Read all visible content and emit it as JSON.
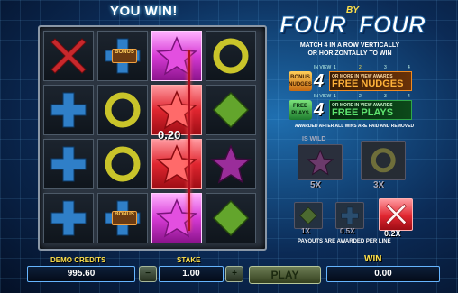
{
  "header": {
    "you_win": "YOU WIN!"
  },
  "logo": {
    "word1": "FOUR",
    "word2": "BY",
    "word3": "FOUR"
  },
  "rules": {
    "line1": "MATCH 4 IN A ROW VERTICALLY",
    "line2": "OR HORIZONTALLY TO WIN",
    "note": "AWARDED AFTER ALL WINS ARE PAID AND REMOVED"
  },
  "nudges_row": {
    "badge_line1": "BONUS",
    "badge_line2": "NUDGES",
    "number": "4",
    "small_text": "OR MORE IN VIEW AWARDS",
    "big_text": "FREE NUDGES",
    "in_view_label": "IN VIEW",
    "in_view_numbers": [
      "1",
      "2",
      "3",
      "4"
    ]
  },
  "freeplays_row": {
    "badge_line1": "FREE",
    "badge_line2": "PLAYS",
    "number": "4",
    "small_text": "OR MORE IN VIEW AWARDS",
    "big_text": "FREE PLAYS",
    "in_view_label": "IN VIEW",
    "in_view_numbers": [
      "1",
      "2",
      "3",
      "4"
    ]
  },
  "grid": {
    "win_amount": "0.20",
    "bonus_tag": "BONUS",
    "cells": [
      [
        "x-red",
        "plus-blue-bonus",
        "star-pink",
        "ring-yellow"
      ],
      [
        "plus-blue",
        "ring-yellow",
        "star-red",
        "diamond-green"
      ],
      [
        "plus-blue",
        "ring-yellow",
        "star-red",
        "star-purple"
      ],
      [
        "plus-blue",
        "plus-blue-bonus",
        "star-pink",
        "diamond-green"
      ]
    ]
  },
  "paytable": {
    "is_wild": "IS WILD",
    "star_mult": "5X",
    "ring_mult": "3X",
    "diamond_mult": "1X",
    "plus_mult": "0.5X",
    "x_mult": "0.2X",
    "payouts_note": "PAYOUTS ARE AWARDED PER LINE"
  },
  "bottom": {
    "credits_label": "DEMO CREDITS",
    "credits_value": "995.60",
    "stake_label": "STAKE",
    "stake_value": "1.00",
    "minus": "−",
    "plus": "+",
    "play": "PLAY",
    "win_label": "WIN",
    "win_value": "0.00"
  },
  "colors": {
    "accent": "#ffe14a",
    "win_red": "#e02630",
    "win_pink": "#d63bd5",
    "nudges_orange": "#f08a20",
    "freeplays_green": "#2ea84a"
  }
}
